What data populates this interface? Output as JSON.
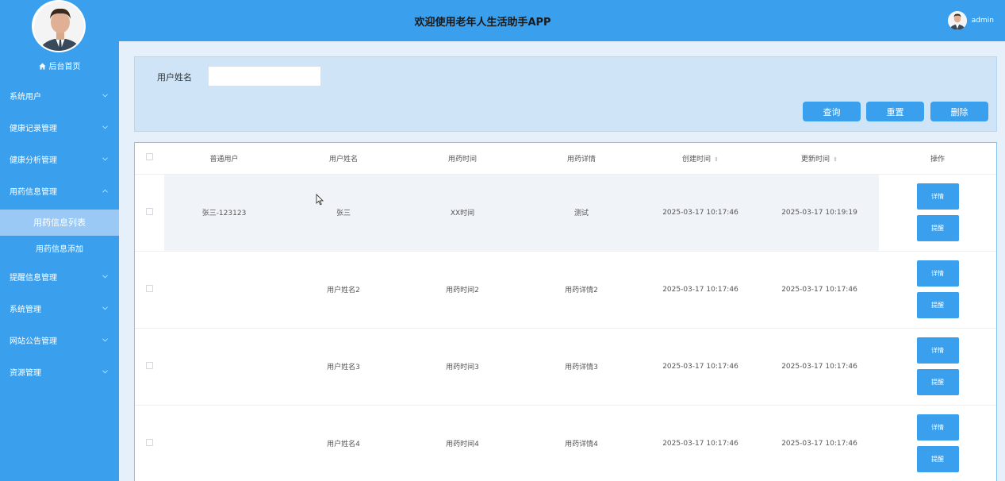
{
  "app": {
    "title": "欢迎使用老年人生活助手APP",
    "user": "admin"
  },
  "sidebar": {
    "home": "后台首页",
    "menus": [
      "系统用户",
      "健康记录管理",
      "健康分析管理",
      "用药信息管理",
      "提醒信息管理",
      "系统管理",
      "网站公告管理",
      "资源管理"
    ],
    "submenus": [
      "用药信息列表",
      "用药信息添加"
    ]
  },
  "search": {
    "label": "用户姓名",
    "value": "",
    "placeholder": ""
  },
  "buttons": {
    "query": "查询",
    "reset": "重置",
    "delete": "删除"
  },
  "table": {
    "headers": [
      "普通用户",
      "用户姓名",
      "用药时间",
      "用药详情",
      "创建时间",
      "更新时间",
      "操作"
    ],
    "rows": [
      {
        "user": "张三-123123",
        "name": "张三",
        "time": "XX时间",
        "detail": "测试",
        "created": "2025-03-17 10:17:46",
        "updated": "2025-03-17 10:19:19"
      },
      {
        "user": "",
        "name": "用户姓名2",
        "time": "用药时间2",
        "detail": "用药详情2",
        "created": "2025-03-17 10:17:46",
        "updated": "2025-03-17 10:17:46"
      },
      {
        "user": "",
        "name": "用户姓名3",
        "time": "用药时间3",
        "detail": "用药详情3",
        "created": "2025-03-17 10:17:46",
        "updated": "2025-03-17 10:17:46"
      },
      {
        "user": "",
        "name": "用户姓名4",
        "time": "用药时间4",
        "detail": "用药详情4",
        "created": "2025-03-17 10:17:46",
        "updated": "2025-03-17 10:17:46"
      }
    ],
    "row_actions": {
      "detail": "详情",
      "remind": "提醒"
    }
  },
  "colors": {
    "primary": "#3aa0ee",
    "submenu_active": "#9bc9f5"
  },
  "icons": [
    "home-icon",
    "chevron-down-icon",
    "chevron-up-icon",
    "sort-icon",
    "mouse-cursor-icon"
  ]
}
